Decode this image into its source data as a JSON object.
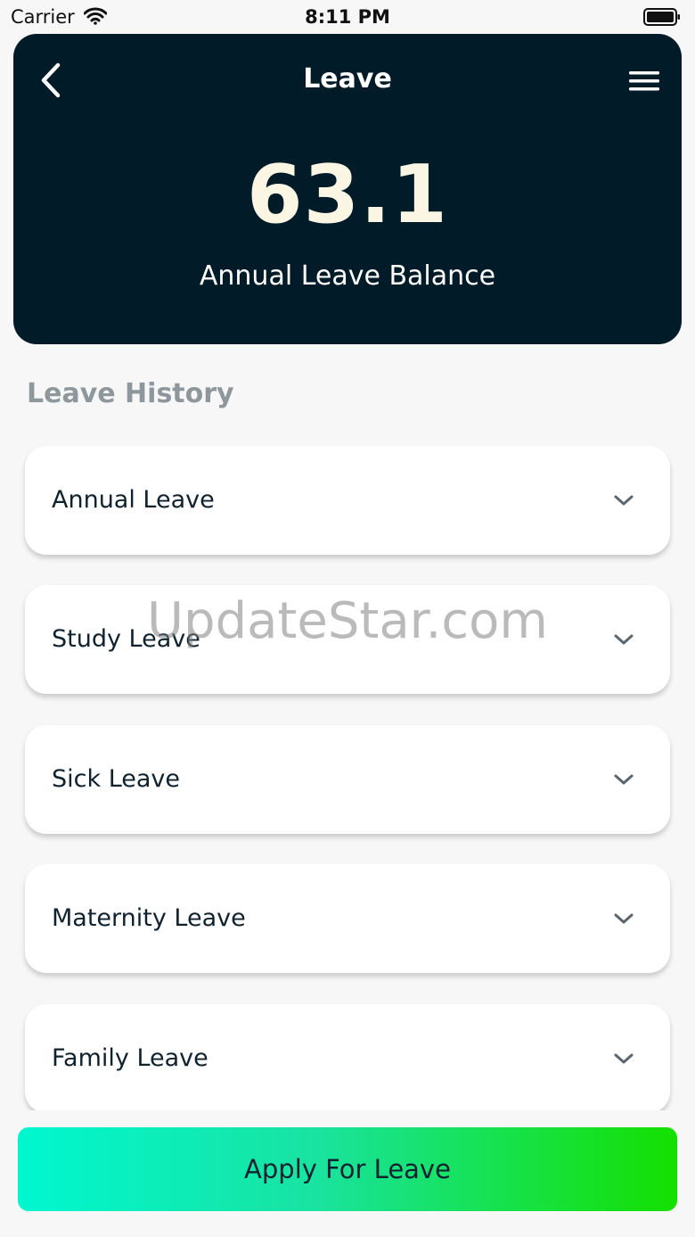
{
  "status_bar": {
    "carrier": "Carrier",
    "time": "8:11 PM",
    "wifi_icon": "wifi-icon",
    "battery_icon": "battery-icon"
  },
  "header": {
    "title": "Leave",
    "back_icon": "chevron-left-icon",
    "menu_icon": "hamburger-menu-icon",
    "balance_value": "63.1",
    "balance_label": "Annual Leave Balance",
    "background_color": "#021b29"
  },
  "history": {
    "title": "Leave History",
    "items": [
      {
        "label": "Annual Leave"
      },
      {
        "label": "Study Leave"
      },
      {
        "label": "Sick Leave"
      },
      {
        "label": "Maternity Leave"
      },
      {
        "label": "Family Leave"
      }
    ],
    "expand_icon": "chevron-down-icon"
  },
  "watermark": "UpdateStar.com",
  "apply_button": {
    "label": "Apply For Leave",
    "gradient_start": "#00f7d0",
    "gradient_end": "#14e000"
  }
}
